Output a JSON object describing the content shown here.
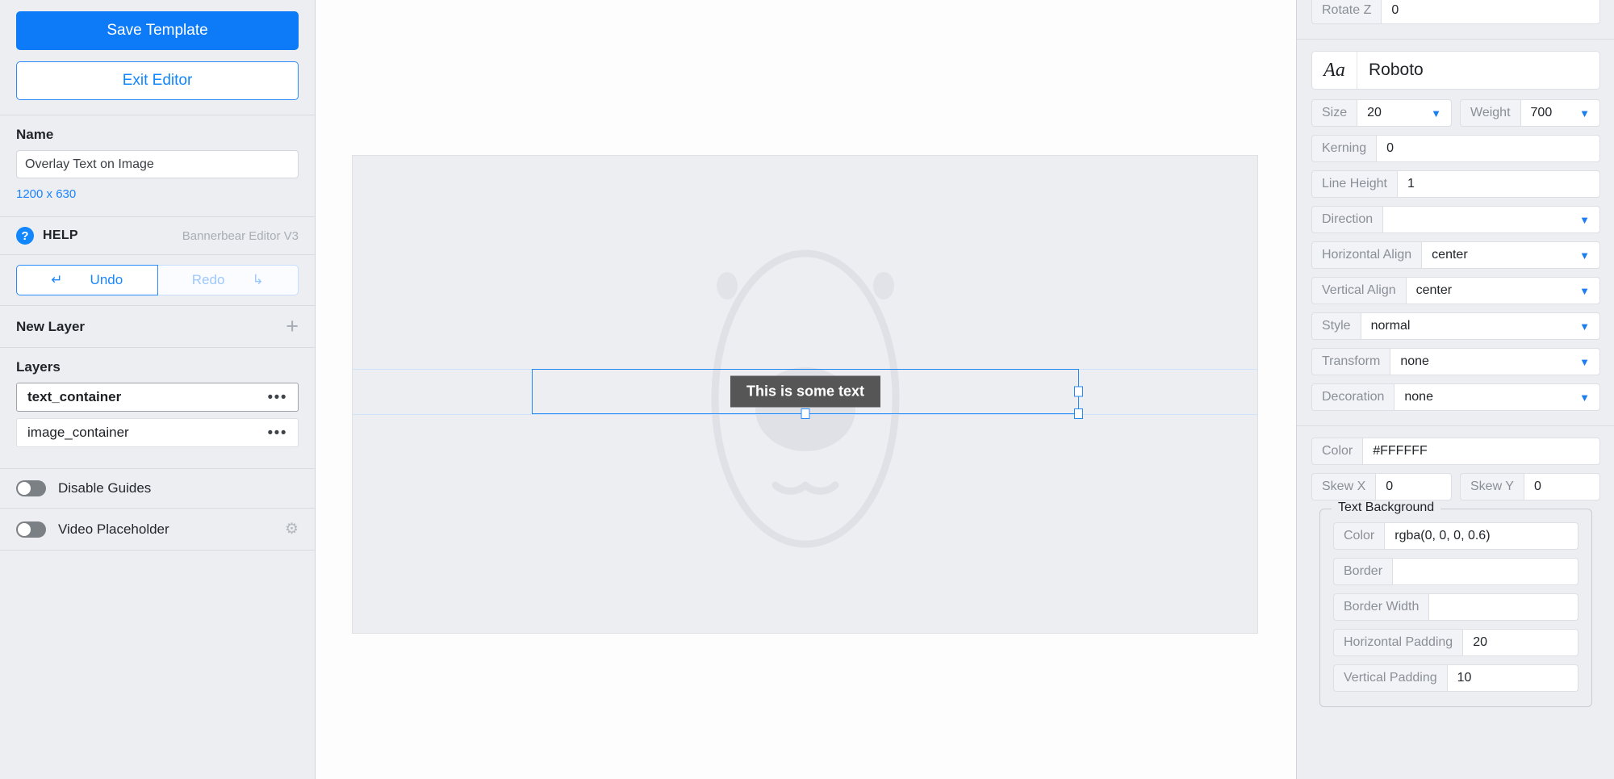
{
  "sidebar": {
    "save_label": "Save Template",
    "exit_label": "Exit Editor",
    "name_label": "Name",
    "name_value": "Overlay Text on Image",
    "dimensions": "1200 x 630",
    "help_icon_glyph": "?",
    "help_label": "HELP",
    "brand_label": "Bannerbear Editor V3",
    "undo_label": "Undo",
    "undo_icon_glyph": "↵",
    "redo_label": "Redo",
    "redo_icon_glyph": "↳",
    "new_layer_label": "New Layer",
    "add_layer_glyph": "+",
    "layers_label": "Layers",
    "layers": [
      {
        "name": "text_container",
        "menu_glyph": "•••",
        "selected": true
      },
      {
        "name": "image_container",
        "menu_glyph": "•••",
        "selected": false
      }
    ],
    "toggles": [
      {
        "label": "Disable Guides",
        "on": false,
        "has_gear": false
      },
      {
        "label": "Video Placeholder",
        "on": false,
        "has_gear": true,
        "gear_glyph": "⚙"
      }
    ]
  },
  "canvas": {
    "text_value": "This is some text",
    "selection_color": "#2488f5"
  },
  "right_panel": {
    "rotate_z_label": "Rotate Z",
    "rotate_z_value": "0",
    "font_icon_glyph": "Aa",
    "font_name": "Roboto",
    "size_label": "Size",
    "size_value": "20",
    "weight_label": "Weight",
    "weight_value": "700",
    "kerning_label": "Kerning",
    "kerning_value": "0",
    "line_height_label": "Line Height",
    "line_height_value": "1",
    "direction_label": "Direction",
    "direction_value": "",
    "horizontal_align_label": "Horizontal Align",
    "horizontal_align_value": "center",
    "vertical_align_label": "Vertical Align",
    "vertical_align_value": "center",
    "style_label": "Style",
    "style_value": "normal",
    "transform_label": "Transform",
    "transform_value": "none",
    "decoration_label": "Decoration",
    "decoration_value": "none",
    "color_label": "Color",
    "color_value": "#FFFFFF",
    "skew_x_label": "Skew X",
    "skew_x_value": "0",
    "skew_y_label": "Skew Y",
    "skew_y_value": "0",
    "text_background": {
      "legend": "Text Background",
      "color_label": "Color",
      "color_value": "rgba(0, 0, 0, 0.6)",
      "border_label": "Border",
      "border_value": "",
      "border_width_label": "Border Width",
      "border_width_value": "",
      "horizontal_padding_label": "Horizontal Padding",
      "horizontal_padding_value": "20",
      "vertical_padding_label": "Vertical Padding",
      "vertical_padding_value": "10"
    },
    "chevron_glyph": "❯"
  }
}
